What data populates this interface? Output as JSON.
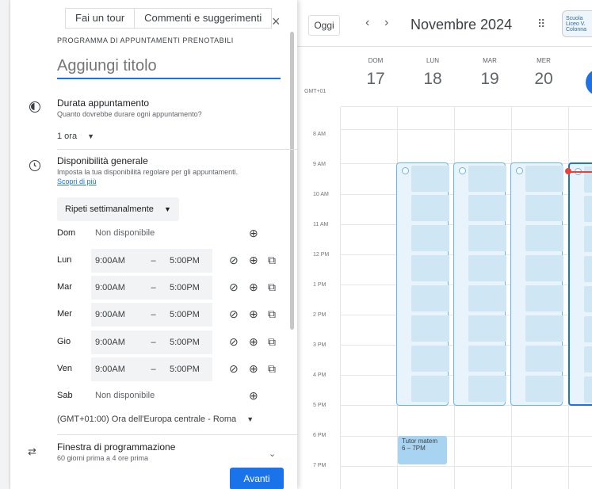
{
  "panel": {
    "tour_button": "Fai un tour",
    "feedback_button": "Commenti e suggerimenti",
    "close_label": "×",
    "heading": "PROGRAMMA DI APPUNTAMENTI PRENOTABILI",
    "title_placeholder": "Aggiungi titolo",
    "duration": {
      "title": "Durata appuntamento",
      "subtitle": "Quanto dovrebbe durare ogni appuntamento?",
      "value": "1 ora"
    },
    "availability": {
      "title": "Disponibilità generale",
      "subtitle": "Imposta la tua disponibilità regolare per gli appuntamenti.",
      "link": "Scopri di più",
      "repeat": "Ripeti settimanalmente"
    },
    "days": [
      {
        "day": "Dom",
        "available": false,
        "text": "Non disponibile"
      },
      {
        "day": "Lun",
        "available": true,
        "start": "9:00AM",
        "end": "5:00PM"
      },
      {
        "day": "Mar",
        "available": true,
        "start": "9:00AM",
        "end": "5:00PM"
      },
      {
        "day": "Mer",
        "available": true,
        "start": "9:00AM",
        "end": "5:00PM"
      },
      {
        "day": "Gio",
        "available": true,
        "start": "9:00AM",
        "end": "5:00PM"
      },
      {
        "day": "Ven",
        "available": true,
        "start": "9:00AM",
        "end": "5:00PM"
      },
      {
        "day": "Sab",
        "available": false,
        "text": "Non disponibile"
      }
    ],
    "dash": "–",
    "timezone": "(GMT+01:00) Ora dell'Europa centrale - Roma",
    "window": {
      "title": "Finestra di programmazione",
      "subtitle": "60 giorni prima a 4 ore prima"
    },
    "next_button": "Avanti"
  },
  "calendar": {
    "today_button": "Oggi",
    "month": "Novembre 2024",
    "logo_text": "Scuola Liceo V. Colonna",
    "gmt": "GMT+01",
    "days": [
      {
        "dow": "DOM",
        "num": "17"
      },
      {
        "dow": "LUN",
        "num": "18"
      },
      {
        "dow": "MAR",
        "num": "19"
      },
      {
        "dow": "MER",
        "num": "20"
      }
    ],
    "hours": [
      "8 AM",
      "9 AM",
      "10 AM",
      "11 AM",
      "12 PM",
      "1 PM",
      "2 PM",
      "3 PM",
      "4 PM",
      "5 PM",
      "6 PM",
      "7 PM"
    ],
    "event": {
      "title": "Tutor matem",
      "time": "6 – 7PM"
    }
  },
  "colors": {
    "accent": "#1a73e8",
    "block_border": "#64b5f6",
    "now_line": "#ea4335"
  },
  "icons": [
    "close-icon",
    "duration-icon",
    "clock-icon",
    "dropdown-arrow-icon",
    "block-icon",
    "add-icon",
    "copy-icon",
    "swap-icon",
    "chevron-down-icon",
    "chevron-left-icon",
    "chevron-right-icon",
    "apps-grid-icon"
  ]
}
